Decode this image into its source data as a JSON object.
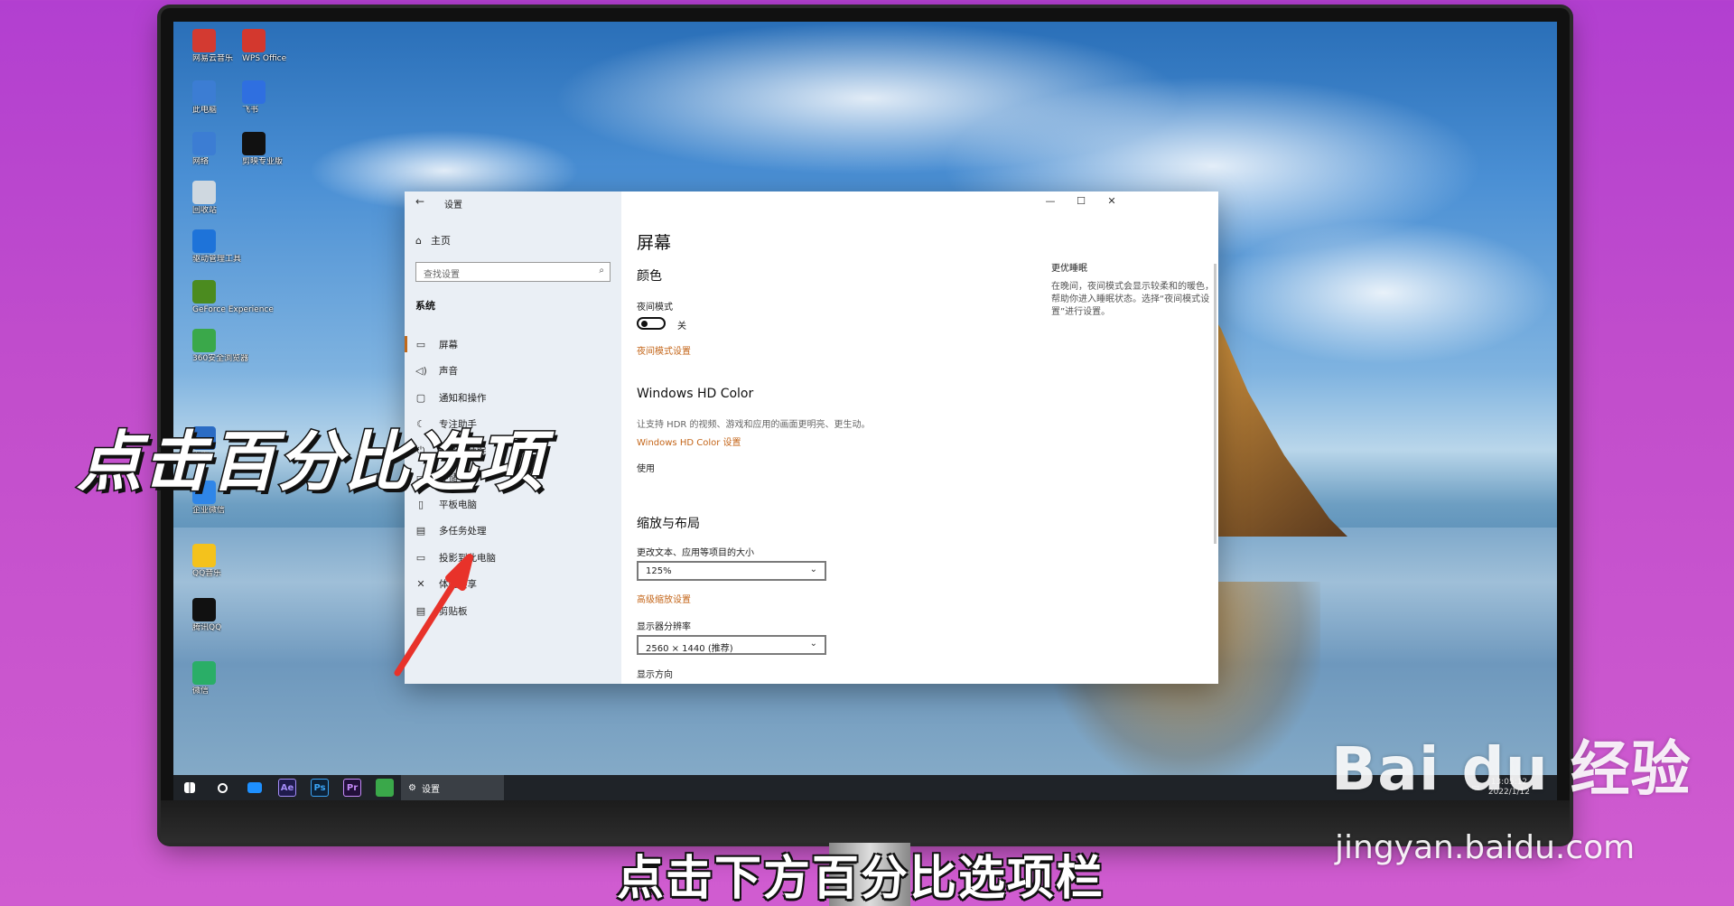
{
  "desktop": {
    "icons": [
      {
        "label": "网易云音乐",
        "color": "#d33a31"
      },
      {
        "label": "WPS Office",
        "color": "#d3382e"
      },
      {
        "label": "此电脑",
        "color": "#3c7dd3"
      },
      {
        "label": "飞书",
        "color": "#2f6fe0"
      },
      {
        "label": "网络",
        "color": "#3c7dd3"
      },
      {
        "label": "剪映专业版",
        "color": "#111111"
      },
      {
        "label": "回收站",
        "color": "#cfd8e0"
      },
      {
        "label": "驱动管理工具",
        "color": "#1e73d9"
      },
      {
        "label": "GeForce Experience",
        "color": "#4b8b1f"
      },
      {
        "label": "360安全浏览器",
        "color": "#3aa84a"
      },
      {
        "label": "零壹",
        "color": "#2b6cc4"
      },
      {
        "label": "企业微信",
        "color": "#2f86e8"
      },
      {
        "label": "QQ音乐",
        "color": "#f4c21c"
      },
      {
        "label": "腾讯QQ",
        "color": "#111111"
      },
      {
        "label": "微信",
        "color": "#2aae67"
      }
    ]
  },
  "taskbar": {
    "apps": [
      {
        "name": "start-icon",
        "text": ""
      },
      {
        "name": "search-icon",
        "text": ""
      },
      {
        "name": "task-view-icon",
        "text": ""
      },
      {
        "name": "after-effects-icon",
        "text": "Ae",
        "bg": "#1f1b4d",
        "fg": "#a38cf7"
      },
      {
        "name": "photoshop-icon",
        "text": "Ps",
        "bg": "#0d2238",
        "fg": "#3aa3f5"
      },
      {
        "name": "premiere-icon",
        "text": "Pr",
        "bg": "#22103a",
        "fg": "#c58af7"
      },
      {
        "name": "browser-icon",
        "text": "",
        "bg": "#3aa84a"
      }
    ],
    "active_app": "设置",
    "time": "13:05:12",
    "date": "2022/1/12"
  },
  "window": {
    "title": "设置",
    "controls": {
      "minimize": "—",
      "maximize": "☐",
      "close": "✕"
    },
    "sidebar": {
      "home": "主页",
      "search_placeholder": "查找设置",
      "section": "系统",
      "items": [
        {
          "label": "屏幕",
          "icon": "monitor-icon",
          "glyph": "▭"
        },
        {
          "label": "声音",
          "icon": "speaker-icon",
          "glyph": "◁)"
        },
        {
          "label": "通知和操作",
          "icon": "notification-icon",
          "glyph": "▢"
        },
        {
          "label": "专注助手",
          "icon": "focus-icon",
          "glyph": "☾"
        },
        {
          "label": "电源和睡眠",
          "icon": "power-icon",
          "glyph": "⏻"
        },
        {
          "label": "存储",
          "icon": "storage-icon",
          "glyph": "▭"
        },
        {
          "label": "平板电脑",
          "icon": "tablet-icon",
          "glyph": "▯"
        },
        {
          "label": "多任务处理",
          "icon": "multitask-icon",
          "glyph": "▤"
        },
        {
          "label": "投影到此电脑",
          "icon": "project-icon",
          "glyph": "▭"
        },
        {
          "label": "体验共享",
          "icon": "share-icon",
          "glyph": "✕"
        },
        {
          "label": "剪贴板",
          "icon": "clipboard-icon",
          "glyph": "▤"
        }
      ]
    },
    "main": {
      "title": "屏幕",
      "color_heading": "颜色",
      "night_mode_label": "夜间模式",
      "night_mode_state": "关",
      "night_mode_link": "夜间模式设置",
      "hdr_heading": "Windows HD Color",
      "hdr_desc": "让支持 HDR 的视频、游戏和应用的画面更明亮、更生动。",
      "hdr_link": "Windows HD Color 设置",
      "use_label": "使用",
      "scale_heading": "缩放与布局",
      "scale_label": "更改文本、应用等项目的大小",
      "scale_value": "125%",
      "advanced_scale_link": "高级缩放设置",
      "resolution_label": "显示器分辨率",
      "resolution_value": "2560 × 1440 (推荐)",
      "orientation_label": "显示方向"
    },
    "help": {
      "title": "更优睡眠",
      "desc": "在晚间，夜间模式会显示较柔和的暖色，帮助你进入睡眠状态。选择“夜间模式设置”进行设置。"
    }
  },
  "overlay": {
    "caption": "点击百分比选项",
    "subtitle": "点击下方百分比选项栏",
    "watermark_logo": "Bai du 经验",
    "watermark_url": "jingyan.baidu.com",
    "arrow_color": "#e8322a"
  }
}
